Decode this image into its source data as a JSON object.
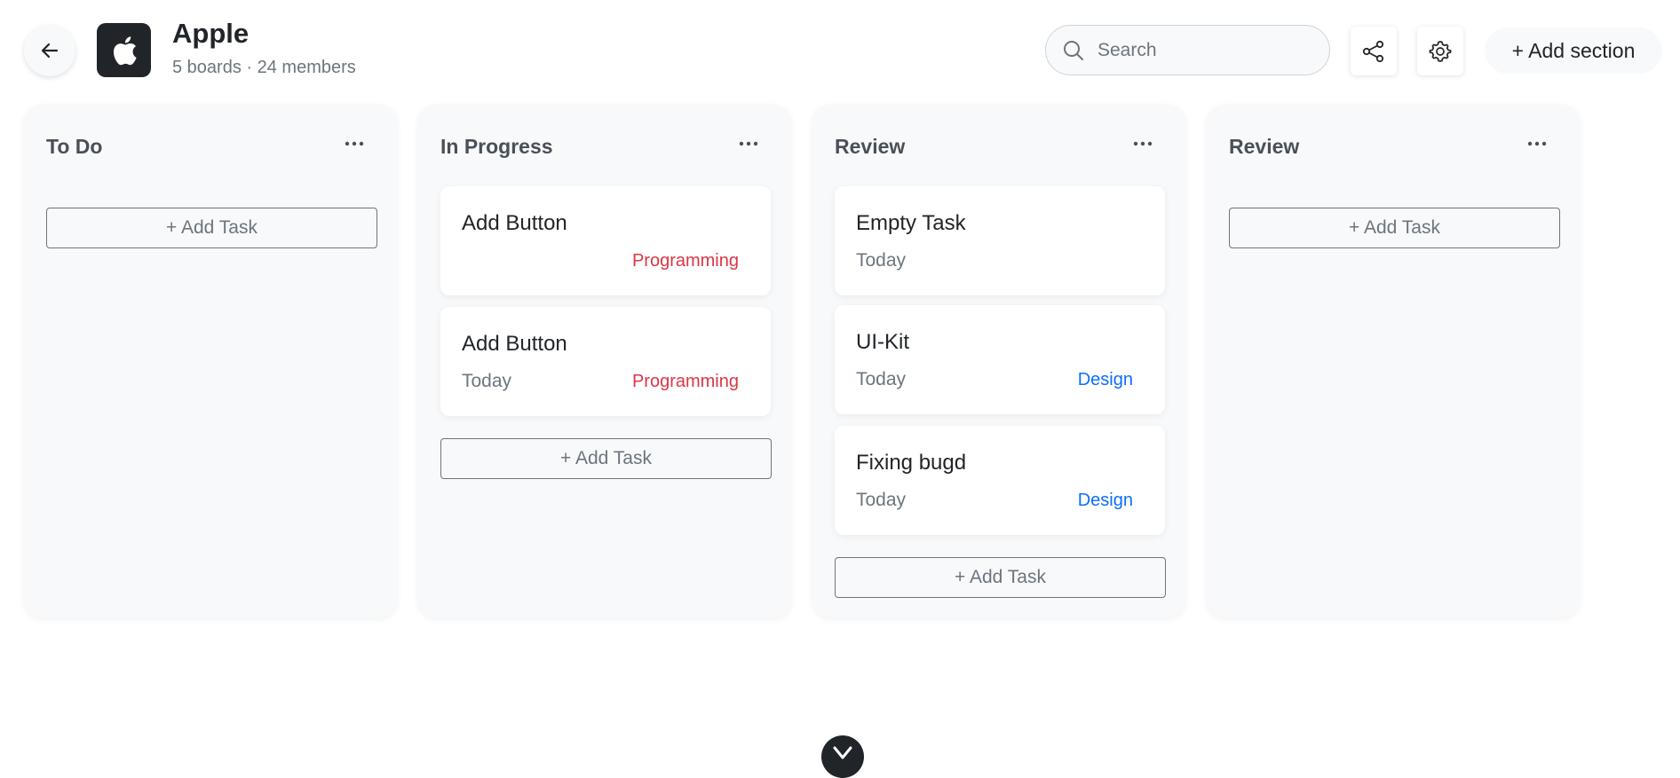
{
  "header": {
    "title": "Apple",
    "subtitle": "5 boards · 24 members",
    "search": {
      "placeholder": "Search",
      "value": ""
    },
    "add_section_label": "+ Add section"
  },
  "columns": [
    {
      "title": "To Do",
      "cards": [],
      "add_task_label": "+ Add Task"
    },
    {
      "title": "In Progress",
      "cards": [
        {
          "title": "Add Button",
          "date": "",
          "tag": "Programming"
        },
        {
          "title": "Add Button",
          "date": "Today",
          "tag": "Programming"
        }
      ],
      "add_task_label": "+ Add Task"
    },
    {
      "title": "Review",
      "cards": [
        {
          "title": "Empty Task",
          "date": "Today",
          "tag": ""
        },
        {
          "title": "UI-Kit",
          "date": "Today",
          "tag": "Design"
        },
        {
          "title": "Fixing bugd",
          "date": "Today",
          "tag": "Design"
        }
      ],
      "add_task_label": "+ Add Task"
    },
    {
      "title": "Review",
      "cards": [],
      "add_task_label": "+ Add Task"
    }
  ],
  "colors": {
    "programming": "#dc3545",
    "design": "#0d6efd",
    "logo_bg": "#212529",
    "column_bg": "#f8f9fa"
  },
  "icons": [
    "arrow-left-icon",
    "apple-logo-icon",
    "search-icon",
    "share-icon",
    "gear-icon",
    "more-horizontal-icon",
    "chevron-down-icon"
  ]
}
